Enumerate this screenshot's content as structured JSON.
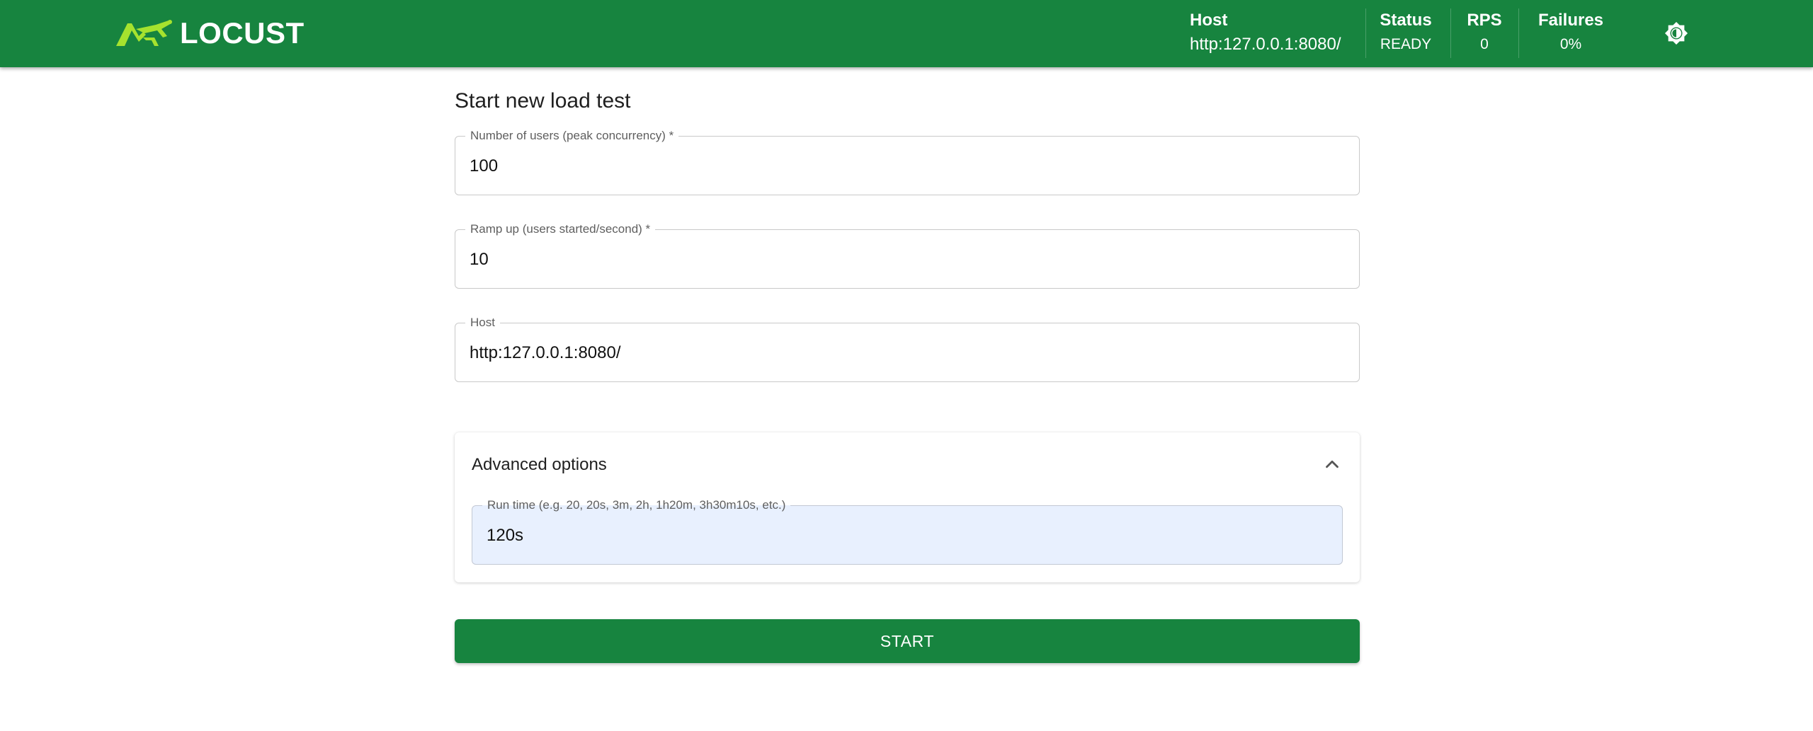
{
  "header": {
    "logo_text": "LOCUST",
    "logo_icon": "grasshopper-logo",
    "brand_color": "#17843f",
    "stats": {
      "host": {
        "label": "Host",
        "value": "http:127.0.0.1:8080/"
      },
      "status": {
        "label": "Status",
        "value": "READY"
      },
      "rps": {
        "label": "RPS",
        "value": "0"
      },
      "failures": {
        "label": "Failures",
        "value": "0%"
      }
    },
    "theme_toggle_icon": "brightness-icon"
  },
  "form": {
    "title": "Start new load test",
    "users": {
      "label": "Number of users (peak concurrency) *",
      "value": "100"
    },
    "ramp_up": {
      "label": "Ramp up (users started/second) *",
      "value": "10"
    },
    "host": {
      "label": "Host",
      "value": "http:127.0.0.1:8080/"
    },
    "advanced": {
      "title": "Advanced options",
      "expanded": true,
      "chevron_icon": "chevron-up-icon",
      "run_time": {
        "label": "Run time (e.g. 20, 20s, 3m, 2h, 1h20m, 3h30m10s, etc.)",
        "value": "120s"
      }
    },
    "start_label": "START"
  }
}
